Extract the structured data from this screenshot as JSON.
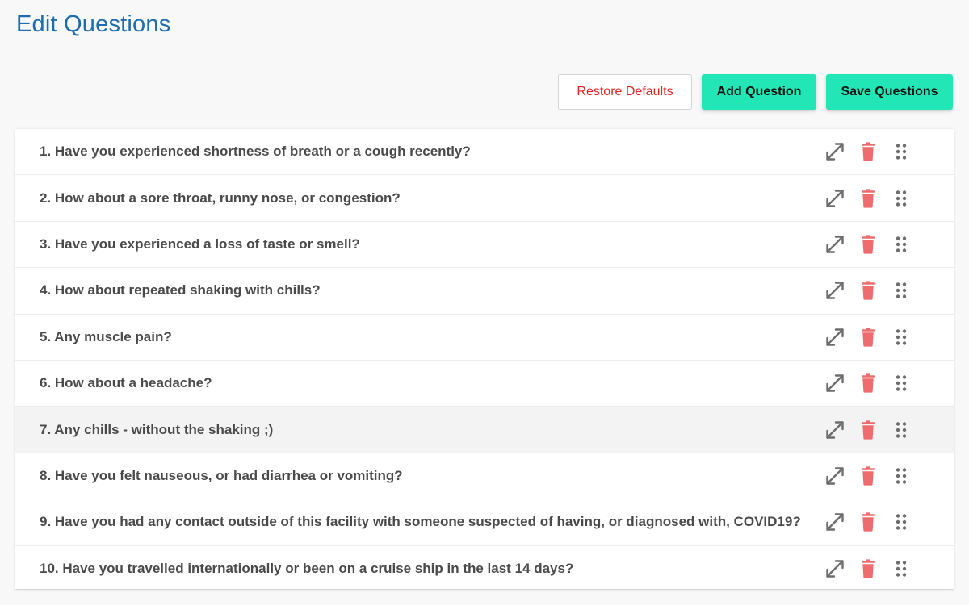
{
  "page": {
    "title": "Edit Questions"
  },
  "toolbar": {
    "restore_label": "Restore Defaults",
    "add_label": "Add Question",
    "save_label": "Save Questions"
  },
  "colors": {
    "title": "#1e6cb0",
    "accent": "#23e6b6",
    "danger": "#e02424",
    "trash_icon": "#ee6b6e",
    "icon_gray": "#6d6d6d"
  },
  "icons": {
    "expand": "expand-icon",
    "delete": "trash-icon",
    "drag": "drag-handle-icon"
  },
  "questions": [
    {
      "text": "1. Have you experienced shortness of breath or a cough recently?"
    },
    {
      "text": "2. How about a sore throat, runny nose, or congestion?"
    },
    {
      "text": "3. Have you experienced a loss of taste or smell?"
    },
    {
      "text": "4. How about repeated shaking with chills?"
    },
    {
      "text": "5. Any muscle pain?"
    },
    {
      "text": "6. How about a headache?"
    },
    {
      "text": "7. Any chills - without the shaking ;)"
    },
    {
      "text": "8. Have you felt nauseous, or had diarrhea or vomiting?"
    },
    {
      "text": "9. Have you had any contact outside of this facility with someone suspected of having, or diagnosed with, COVID19?"
    },
    {
      "text": "10. Have you travelled internationally or been on a cruise ship in the last 14 days?"
    }
  ]
}
